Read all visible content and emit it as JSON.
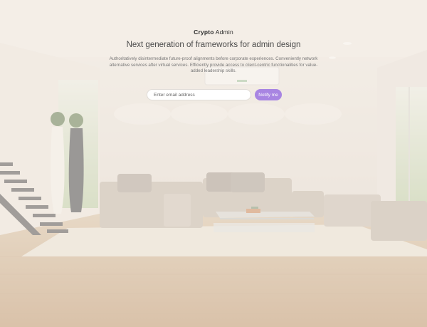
{
  "brand": {
    "bold": "Crypto",
    "light": "Admin"
  },
  "headline": "Next generation of frameworks for admin design",
  "description": "Authoritatively disintermediate future-proof alignments before corporate experiences. Conveniently network alternative services after virtual services. Efficiently provide access to client-centric functionalities for value-added leadership skills.",
  "form": {
    "email_placeholder": "Enter email address",
    "email_value": "",
    "button_label": "Notify me"
  },
  "colors": {
    "accent": "#a885e2",
    "wash": "#f4ece4"
  }
}
